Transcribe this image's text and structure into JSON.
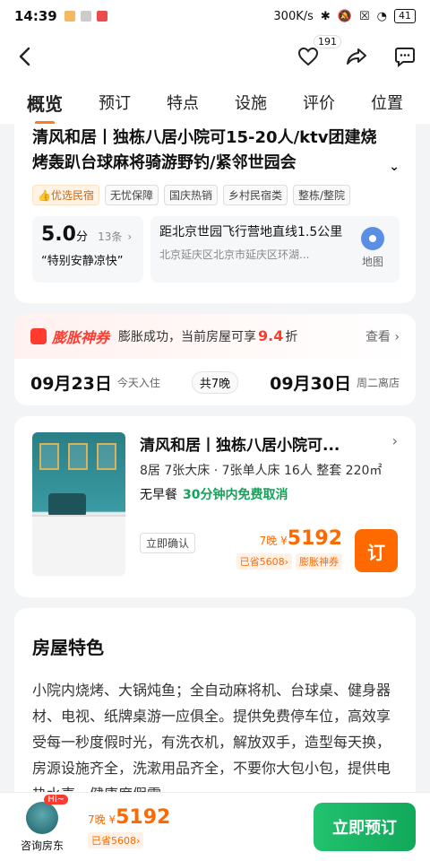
{
  "status": {
    "time": "14:39",
    "speed": "300K/s",
    "battery": "41"
  },
  "header": {
    "fav_count": "191"
  },
  "tabs": [
    "概览",
    "预订",
    "特点",
    "设施",
    "评价",
    "位置"
  ],
  "listing": {
    "title": "清风和居丨独栋八居小院可15-20人/ktv团建烧烤轰趴台球麻将骑游野钓/紧邻世园会",
    "tags": [
      "优选民宿",
      "无忧保障",
      "国庆热销",
      "乡村民宿类",
      "整栋/整院"
    ],
    "rating": {
      "score": "5.0",
      "unit": "分",
      "count": "13条",
      "quote": "“特别安静凉快”"
    },
    "location": {
      "distance": "距北京世园飞行营地直线1.5公里",
      "address": "北京延庆区北京市延庆区环湖...",
      "map_label": "地图"
    }
  },
  "promo": {
    "badge": "膨胀神券",
    "text_prefix": "膨胀成功，当前房屋可享",
    "rate": "9.4",
    "text_suffix": "折",
    "more": "查看"
  },
  "dates": {
    "checkin": "09月23日",
    "checkin_sub": "今天入住",
    "nights": "共7晚",
    "checkout": "09月30日",
    "checkout_sub": "周二离店"
  },
  "room": {
    "title": "清风和居丨独栋八居小院可...",
    "desc": "8居 7张大床 · 7张单人床 16人 整套 220㎡",
    "breakfast": "无早餐",
    "cancel": "30分钟内免费取消",
    "confirm": "立即确认",
    "nights": "7晚",
    "currency": "¥",
    "price": "5192",
    "saved": "已省5608",
    "coupon": "膨胀神券",
    "book": "订"
  },
  "features": {
    "title": "房屋特色",
    "text": "小院内烧烤、大锅炖鱼；全自动麻将机、台球桌、健身器材、电视、纸牌桌游一应俱全。提供免费停车位，高效享受每一秒度假时光，有洗衣机，解放双手，造型每天换，房源设施齐全，洗漱用品齐全，不要你大包小包，提供电热水壶，健康度假零"
  },
  "bottom": {
    "hi": "Hi~",
    "host": "咨询房东",
    "nights": "7晚",
    "currency": "¥",
    "price": "5192",
    "saved": "已省5608",
    "book_now": "立即预订"
  }
}
